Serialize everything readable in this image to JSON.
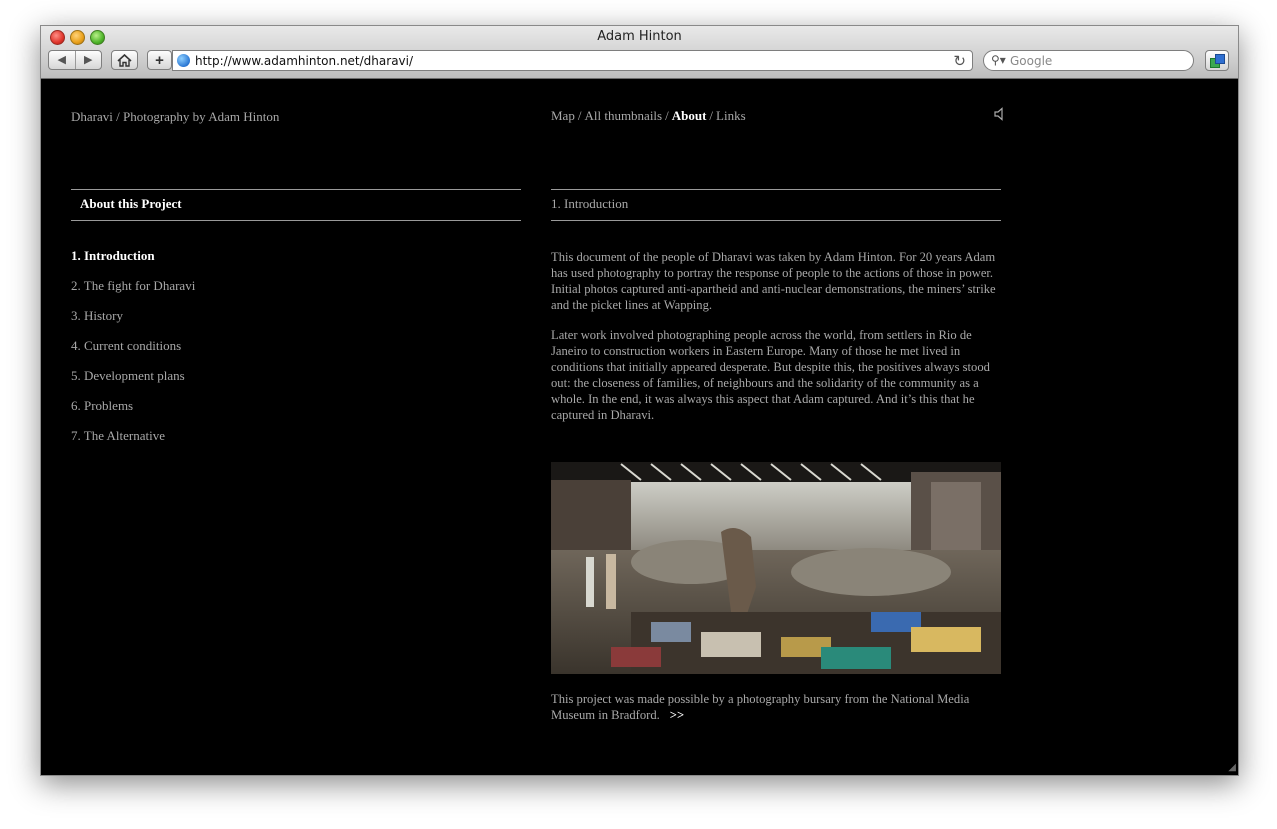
{
  "window": {
    "title": "Adam Hinton"
  },
  "toolbar": {
    "back_icon": "back-arrow-icon",
    "forward_icon": "forward-arrow-icon",
    "home_icon": "home-icon",
    "add_label": "+",
    "url": "http://www.adamhinton.net/dharavi/",
    "search_placeholder": "Google"
  },
  "site": {
    "title": "Dharavi / Photography by Adam Hinton",
    "nav": [
      {
        "label": "Map",
        "active": false
      },
      {
        "label": "All thumbnails",
        "active": false
      },
      {
        "label": "About",
        "active": true
      },
      {
        "label": "Links",
        "active": false
      }
    ],
    "nav_separator": "/"
  },
  "sidebar": {
    "heading": "About this Project",
    "items": [
      {
        "label": "1. Introduction",
        "active": true
      },
      {
        "label": "2. The fight for Dharavi",
        "active": false
      },
      {
        "label": "3. History",
        "active": false
      },
      {
        "label": "4. Current conditions",
        "active": false
      },
      {
        "label": "5. Development plans",
        "active": false
      },
      {
        "label": "6. Problems",
        "active": false
      },
      {
        "label": "7. The Alternative",
        "active": false
      }
    ]
  },
  "article": {
    "heading": "1. Introduction",
    "paragraphs": [
      "This document of the people of Dharavi was taken by Adam Hinton. For 20 years Adam has used photography to portray the response of people to the actions of those in power. Initial photos captured anti-apartheid and anti-nuclear demonstrations, the miners’ strike and the picket lines at Wapping.",
      "Later work involved photographing people across the world, from settlers in Rio de Janeiro to construction workers in Eastern Europe. Many of those he met lived in conditions that initially appeared desperate. But despite this, the positives always stood out: the closeness of families, of neighbours and the solidarity of the community as a whole. In the end, it was always this aspect that Adam captured. And it’s this that he captured in Dharavi."
    ],
    "caption": "This project was made possible by a photography bursary from the National Media Museum in Bradford.",
    "more_label": ">>"
  },
  "colors": {
    "background": "#000000",
    "text": "#a9a9a9",
    "active": "#ffffff"
  }
}
